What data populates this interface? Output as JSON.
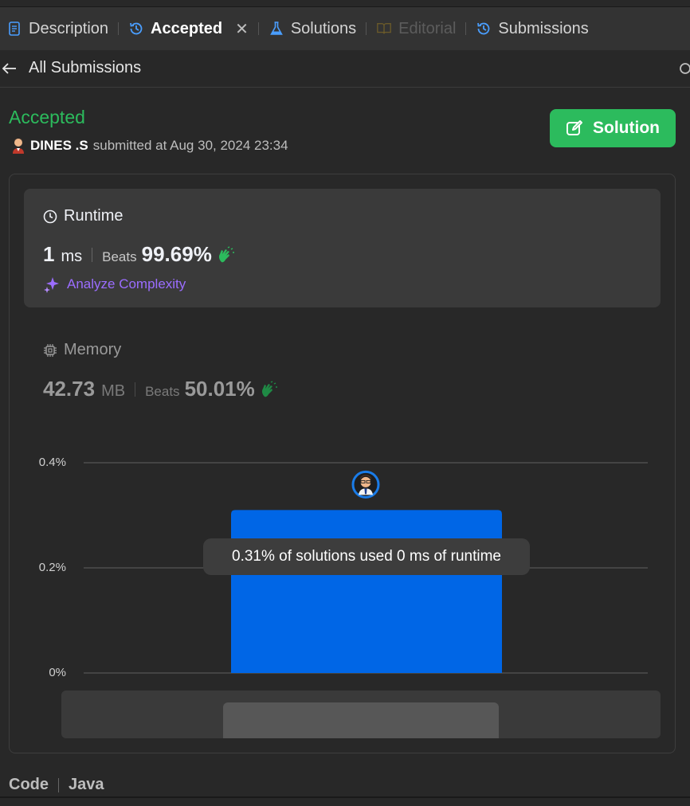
{
  "tabs": [
    {
      "label": "Description",
      "icon": "document-icon",
      "state": "normal"
    },
    {
      "label": "Accepted",
      "icon": "history-icon",
      "state": "active"
    },
    {
      "label": "Solutions",
      "icon": "flask-icon",
      "state": "normal"
    },
    {
      "label": "Editorial",
      "icon": "book-icon",
      "state": "disabled"
    },
    {
      "label": "Submissions",
      "icon": "history-icon",
      "state": "normal"
    }
  ],
  "subbar": {
    "back_label": "All Submissions"
  },
  "submission": {
    "status": "Accepted",
    "user": "DINES .S",
    "submitted_text": "submitted at Aug 30, 2024 23:34"
  },
  "solution_button": {
    "label": "Solution"
  },
  "runtime": {
    "title": "Runtime",
    "value": "1",
    "unit": "ms",
    "beats_label": "Beats",
    "beats_value": "99.69%",
    "analyze_label": "Analyze Complexity"
  },
  "memory": {
    "title": "Memory",
    "value": "42.73",
    "unit": "MB",
    "beats_label": "Beats",
    "beats_value": "50.01%"
  },
  "chart_data": {
    "type": "bar",
    "categories": [
      "0 ms"
    ],
    "values": [
      0.31
    ],
    "ylim": [
      0,
      0.4
    ],
    "yticks": [
      "0%",
      "0.2%",
      "0.4%"
    ],
    "grid": true,
    "tooltip": "0.31% of solutions used 0 ms of runtime"
  },
  "code_section": {
    "label": "Code",
    "language": "Java"
  },
  "colors": {
    "accepted": "#2cbb5d",
    "bar": "#0066e6",
    "accent_blue": "#4a9eff",
    "analyze": "#9b6dff",
    "hands": "#2cbb5d"
  }
}
